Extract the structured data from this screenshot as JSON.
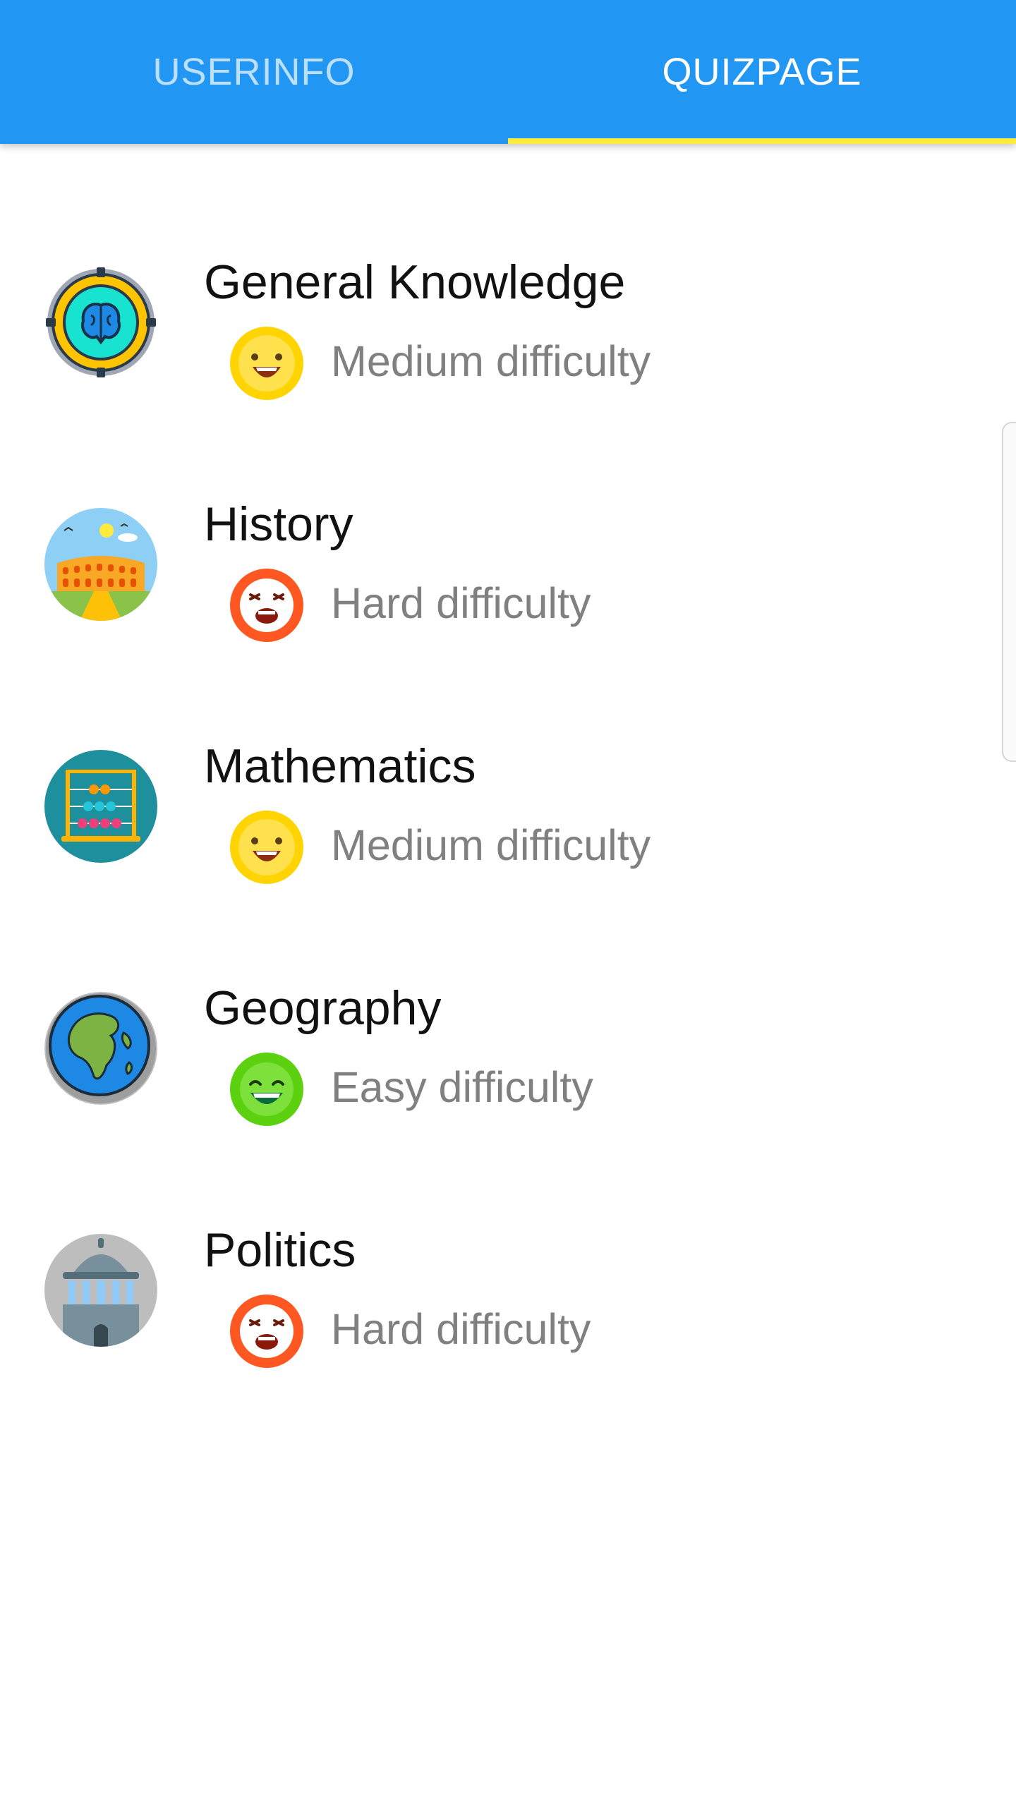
{
  "tabs": [
    {
      "label": "USERINFO",
      "active": false
    },
    {
      "label": "QUIZPAGE",
      "active": true
    }
  ],
  "colors": {
    "tabbar_bg": "#2196F3",
    "tab_indicator": "#FFEB3B",
    "title_text": "#111111",
    "difficulty_text": "#808080",
    "easy": "#5BD10F",
    "medium": "#FFD400",
    "hard": "#FF5722"
  },
  "quizzes": [
    {
      "title": "General Knowledge",
      "icon": "brain-gear-icon",
      "difficulty_level": "medium",
      "difficulty_icon": "medium-face-icon",
      "difficulty_label": "Medium difficulty"
    },
    {
      "title": "History",
      "icon": "colosseum-icon",
      "difficulty_level": "hard",
      "difficulty_icon": "hard-face-icon",
      "difficulty_label": "Hard difficulty"
    },
    {
      "title": "Mathematics",
      "icon": "abacus-icon",
      "difficulty_level": "medium",
      "difficulty_icon": "medium-face-icon",
      "difficulty_label": "Medium difficulty"
    },
    {
      "title": "Geography",
      "icon": "globe-icon",
      "difficulty_level": "easy",
      "difficulty_icon": "easy-face-icon",
      "difficulty_label": "Easy difficulty"
    },
    {
      "title": "Politics",
      "icon": "capitol-building-icon",
      "difficulty_level": "hard",
      "difficulty_icon": "hard-face-icon",
      "difficulty_label": "Hard difficulty"
    }
  ]
}
